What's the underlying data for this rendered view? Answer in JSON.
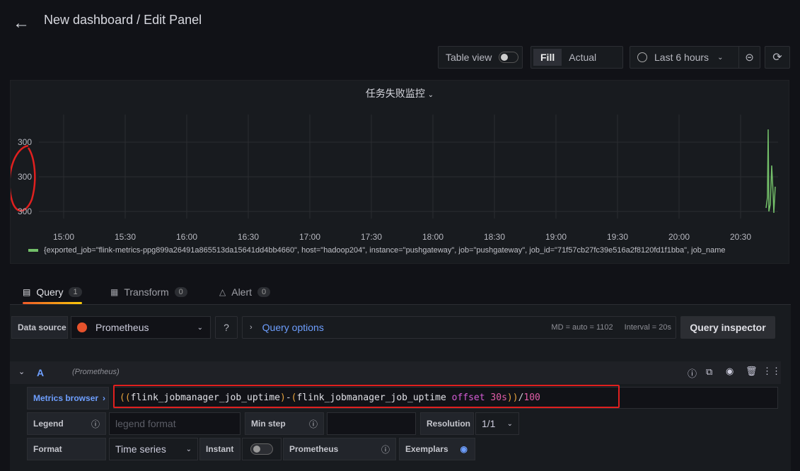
{
  "header": {
    "back_icon": "arrow-left-icon",
    "title": "New dashboard / Edit Panel"
  },
  "toolbar": {
    "table_view_label": "Table view",
    "fill_label": "Fill",
    "actual_label": "Actual",
    "time_range_label": "Last 6 hours",
    "zoom_out_icon": "zoom-out-icon",
    "refresh_icon": "refresh-icon"
  },
  "panel": {
    "title": "任务失败监控",
    "y_ticks": [
      "300",
      "300",
      "300"
    ],
    "x_ticks": [
      "15:00",
      "15:30",
      "16:00",
      "16:30",
      "17:00",
      "17:30",
      "18:00",
      "18:30",
      "19:00",
      "19:30",
      "20:00",
      "20:30"
    ],
    "legend_text": "{exported_job=\"flink-metrics-ppg899a26491a865513da15641dd4bb4660\", host=\"hadoop204\", instance=\"pushgateway\", job=\"pushgateway\", job_id=\"71f57cb27fc39e516a2f8120fd1f1bba\", job_name",
    "series_color": "#73bf69"
  },
  "tabs": [
    {
      "label": "Query",
      "count": "1",
      "icon": "database-icon"
    },
    {
      "label": "Transform",
      "count": "0",
      "icon": "transform-icon"
    },
    {
      "label": "Alert",
      "count": "0",
      "icon": "bell-icon"
    }
  ],
  "query": {
    "datasource_label": "Data source",
    "datasource_value": "Prometheus",
    "query_options_label": "Query options",
    "md_info": "MD = auto = 1102",
    "interval_info": "Interval = 20s",
    "inspector_label": "Query inspector",
    "row_letter": "A",
    "row_source": "(Prometheus)",
    "metrics_browser_label": "Metrics browser",
    "expr": {
      "p1": "((",
      "m1": "flink_jobmanager_job_uptime",
      "p2": ")",
      "minus": "-",
      "p3": "(",
      "m2": "flink_jobmanager_job_uptime",
      "kw": "offset",
      "dur": "30s",
      "p4": "))",
      "div": "/",
      "num": "100"
    },
    "legend_label": "Legend",
    "legend_placeholder": "legend format",
    "minstep_label": "Min step",
    "resolution_label": "Resolution",
    "resolution_value": "1/1",
    "format_label": "Format",
    "format_value": "Time series",
    "instant_label": "Instant",
    "prometheus_label": "Prometheus",
    "exemplars_label": "Exemplars"
  },
  "colors": {
    "accent": "#6e9fff",
    "annotation_red": "#e0201f"
  }
}
